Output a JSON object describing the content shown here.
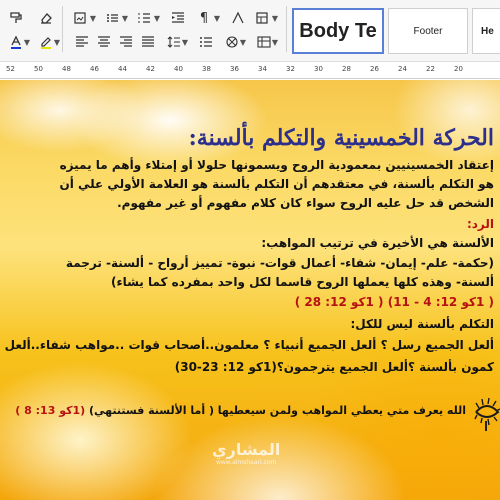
{
  "toolbar": {
    "selected_style": "Body Te",
    "style_footer": "Footer",
    "style_cut": "He",
    "icons": [
      "paint-format-icon",
      "clear-format-icon",
      "font-color-icon",
      "highlight-icon",
      "paragraph-icon",
      "style-icon",
      "align-left-icon",
      "align-center-icon",
      "align-right-icon",
      "justify-icon",
      "list-icon",
      "line-spacing-icon",
      "image-icon",
      "table-icon",
      "more-icon"
    ]
  },
  "ruler": {
    "labels": [
      "52",
      "50",
      "48",
      "46",
      "44",
      "42",
      "40",
      "38",
      "36",
      "34",
      "32",
      "30",
      "28",
      "26",
      "24",
      "22",
      "20"
    ]
  },
  "slide": {
    "title": "الحركة الخمسينية والتكلم بألسنة:",
    "lines": [
      "إعتقاد الخمسينيين بمعمودية الروح ويسمونها حلولا أو إمتلاء وأهم ما يميزه",
      "هو التكلم بألسنة، في معتقدهم أن التكلم بألسنة هو العلامة الأولي علي أن",
      "الشخص قد حل عليه الروح سواء كان كلام مفهوم أو غير مفهوم.",
      "الرد:",
      "الألسنة هي الأخيرة في ترتيب المواهب:",
      "(حكمة- علم- إيمان- شفاء- أعمال قوات- نبوة- تمييز أرواح - ألسنة- ترجمة",
      "ألسنة- وهذه كلها يعملها الروح قاسما لكل واحد بمفرده كما يشاء)",
      "( 1كو 12: 4 - 11) ( 1كو 12: 28 )",
      "التكلم بألسنة ليس للكل:",
      "ألعل الجميع رسل ؟ ألعل الجميع أنبياء ؟ معلمون..أصحاب قوات ..مواهب شفاء..ألعل الجميع",
      "كمون بألسنة ؟ألعل الجميع يترجمون؟(1كو 12: 23-30)"
    ],
    "last_line": "الله يعرف متي يعطي المواهب ولمن سيعطيها ( أما الألسنة فستنتهي)",
    "last_ref": "(1كو 13: 8 )",
    "watermark": "المشاري",
    "watermark_sub": "www.almshaari.com"
  },
  "colors": {
    "title": "#2c2f8c",
    "text": "#121212",
    "accent_red": "#b71212",
    "selection_border": "#5a7fd6"
  }
}
